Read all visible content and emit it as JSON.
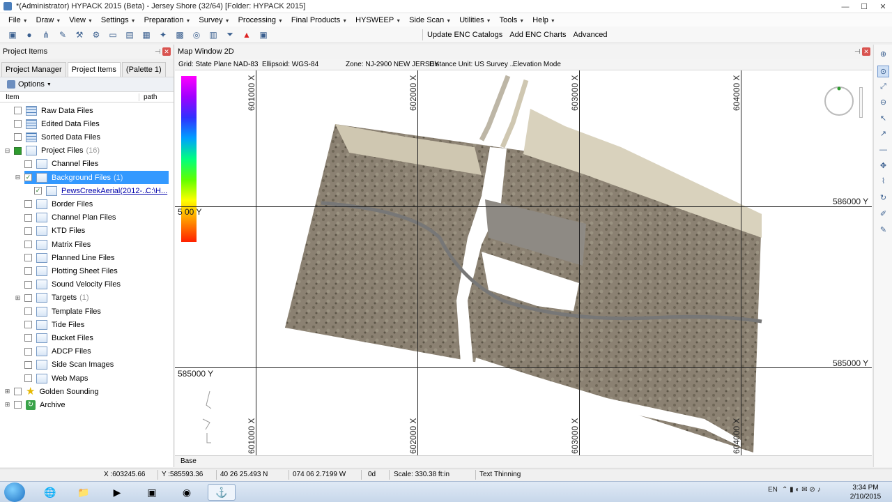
{
  "window": {
    "title": "*(Administrator) HYPACK 2015 (Beta) - Jersey Shore (32/64)  [Folder: HYPACK 2015]",
    "controls": [
      "—",
      "☐",
      "✕"
    ]
  },
  "menu": [
    {
      "label": "File"
    },
    {
      "label": "Draw"
    },
    {
      "label": "View"
    },
    {
      "label": "Settings"
    },
    {
      "label": "Preparation"
    },
    {
      "label": "Survey"
    },
    {
      "label": "Processing"
    },
    {
      "label": "Final Products"
    },
    {
      "label": "HYSWEEP"
    },
    {
      "label": "Side Scan"
    },
    {
      "label": "Utilities"
    },
    {
      "label": "Tools"
    },
    {
      "label": "Help"
    }
  ],
  "toolbar": {
    "update_enc": "Update ENC Catalogs",
    "add_enc": "Add ENC Charts",
    "advanced": "Advanced"
  },
  "left_panel": {
    "title": "Project Items",
    "tabs": [
      "Project Manager",
      "Project Items",
      "(Palette 1)"
    ],
    "active_tab": 1,
    "options_label": "Options",
    "columns": [
      "Item",
      "path"
    ],
    "items": [
      {
        "label": "Raw Data Files",
        "level": 0,
        "icon": "grid-folder-icon"
      },
      {
        "label": "Edited Data Files",
        "level": 0,
        "icon": "grid-folder-icon"
      },
      {
        "label": "Sorted Data Files",
        "level": 0,
        "icon": "grid-folder-icon"
      },
      {
        "label": "Project Files",
        "count": "(16)",
        "level": 0,
        "icon": "folder-icon",
        "expander": "⊟",
        "checked": "green"
      },
      {
        "label": "Channel Files",
        "level": 1,
        "icon": "folder-icon"
      },
      {
        "label": "Background Files",
        "count": "(1)",
        "level": 1,
        "icon": "folder-icon",
        "expander": "⊟",
        "checked": "check",
        "selected": true
      },
      {
        "label": "PewsCreekAerial(2012-...",
        "path": "C:\\H...",
        "level": 2,
        "icon": "file-icon",
        "checked": "check"
      },
      {
        "label": "Border Files",
        "level": 1,
        "icon": "folder-icon"
      },
      {
        "label": "Channel Plan Files",
        "level": 1,
        "icon": "folder-icon"
      },
      {
        "label": "KTD Files",
        "level": 1,
        "icon": "folder-icon"
      },
      {
        "label": "Matrix Files",
        "level": 1,
        "icon": "folder-icon"
      },
      {
        "label": "Planned Line Files",
        "level": 1,
        "icon": "folder-icon"
      },
      {
        "label": "Plotting Sheet Files",
        "level": 1,
        "icon": "folder-icon"
      },
      {
        "label": "Sound Velocity Files",
        "level": 1,
        "icon": "folder-icon"
      },
      {
        "label": "Targets",
        "count": "(1)",
        "level": 1,
        "icon": "folder-icon",
        "expander": "⊞"
      },
      {
        "label": "Template Files",
        "level": 1,
        "icon": "folder-icon"
      },
      {
        "label": "Tide Files",
        "level": 1,
        "icon": "folder-icon"
      },
      {
        "label": "Bucket Files",
        "level": 1,
        "icon": "folder-icon"
      },
      {
        "label": "ADCP Files",
        "level": 1,
        "icon": "folder-icon"
      },
      {
        "label": "Side Scan Images",
        "level": 1,
        "icon": "folder-icon"
      },
      {
        "label": "Web Maps",
        "level": 1,
        "icon": "folder-icon"
      },
      {
        "label": "Golden Sounding",
        "level": 0,
        "icon": "star-icon",
        "expander": "⊞"
      },
      {
        "label": "Archive",
        "level": 0,
        "icon": "recycle-icon",
        "expander": "⊞"
      }
    ]
  },
  "map_window": {
    "title": "Map Window 2D",
    "info": {
      "grid": "Grid: State Plane NAD-83",
      "ellipsoid": "Ellipsoid: WGS-84",
      "zone": "Zone: NJ-2900 NEW JERSEY",
      "unit": "Distance Unit: US Survey ...",
      "mode": "Elevation Mode"
    },
    "grid_labels": {
      "x_top": [
        "601000 X",
        "602000 X",
        "603000 X",
        "604000 X"
      ],
      "x_bottom": [
        "601000 X",
        "602000 X",
        "603000 X",
        "604000 X"
      ],
      "y_right": [
        "586000 Y",
        "585000 Y"
      ],
      "y_left": [
        "5   00 Y",
        "585000 Y"
      ]
    },
    "base_tab": "Base"
  },
  "status": {
    "x": "X :603245.66",
    "y": "Y :585593.36",
    "lat": "40 26 25.493 N",
    "lon": "074 06 2.7199 W",
    "depth": "0d",
    "scale": "Scale: 330.38 ft:in",
    "thinning": "Text Thinning"
  },
  "taskbar": {
    "language": "EN",
    "time": "3:34 PM",
    "date": "2/10/2015"
  },
  "colors": {
    "selection": "#3399ff",
    "close": "#d9534f",
    "grid_line": "#222222"
  }
}
